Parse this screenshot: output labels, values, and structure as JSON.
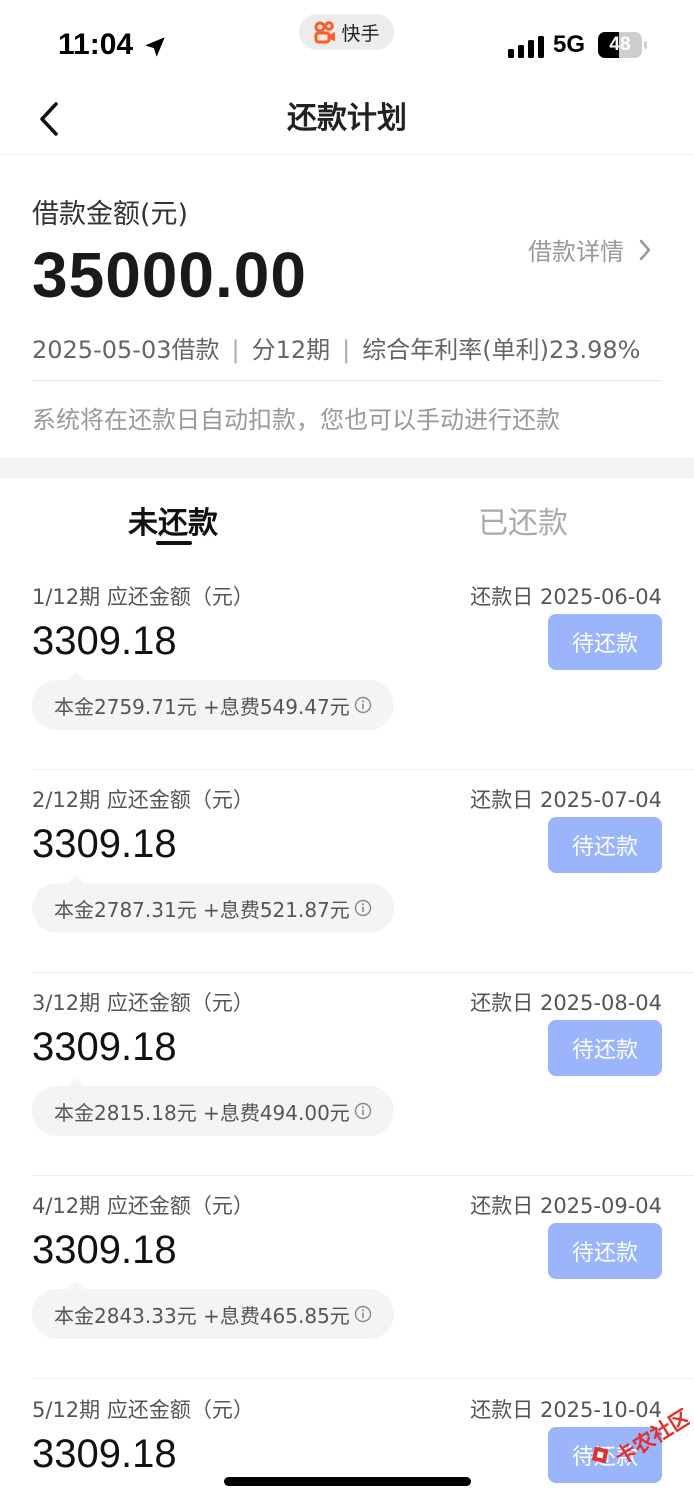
{
  "status_bar": {
    "time": "11:04",
    "app_name": "快手",
    "network": "5G",
    "battery": "48",
    "battery_level": 0.48
  },
  "nav": {
    "title": "还款计划"
  },
  "summary": {
    "amount_label": "借款金额(元)",
    "amount": "35000.00",
    "detail_link": "借款详情",
    "loan_date": "2025-05-03借款",
    "sep": "|",
    "periods": "分12期",
    "rate": "综合年利率(单利)23.98%",
    "notice": "系统将在还款日自动扣款，您也可以手动进行还款"
  },
  "tabs": [
    {
      "label": "未还款"
    },
    {
      "label": "已还款"
    }
  ],
  "installments": [
    {
      "period": "1/12期 应还金额（元）",
      "due": "还款日 2025-06-04",
      "amount": "3309.18",
      "button": "待还款",
      "breakdown": "本金2759.71元 +息费549.47元"
    },
    {
      "period": "2/12期 应还金额（元）",
      "due": "还款日 2025-07-04",
      "amount": "3309.18",
      "button": "待还款",
      "breakdown": "本金2787.31元 +息费521.87元"
    },
    {
      "period": "3/12期 应还金额（元）",
      "due": "还款日 2025-08-04",
      "amount": "3309.18",
      "button": "待还款",
      "breakdown": "本金2815.18元 +息费494.00元"
    },
    {
      "period": "4/12期 应还金额（元）",
      "due": "还款日 2025-09-04",
      "amount": "3309.18",
      "button": "待还款",
      "breakdown": "本金2843.33元 +息费465.85元"
    },
    {
      "period": "5/12期 应还金额（元）",
      "due": "还款日 2025-10-04",
      "amount": "3309.18",
      "button": "待还款",
      "breakdown": ""
    }
  ],
  "watermark": {
    "text": "卡农社区"
  },
  "colors": {
    "button": "#9bb5fb",
    "app_logo": "#ff5c26",
    "watermark": "#e03030"
  }
}
